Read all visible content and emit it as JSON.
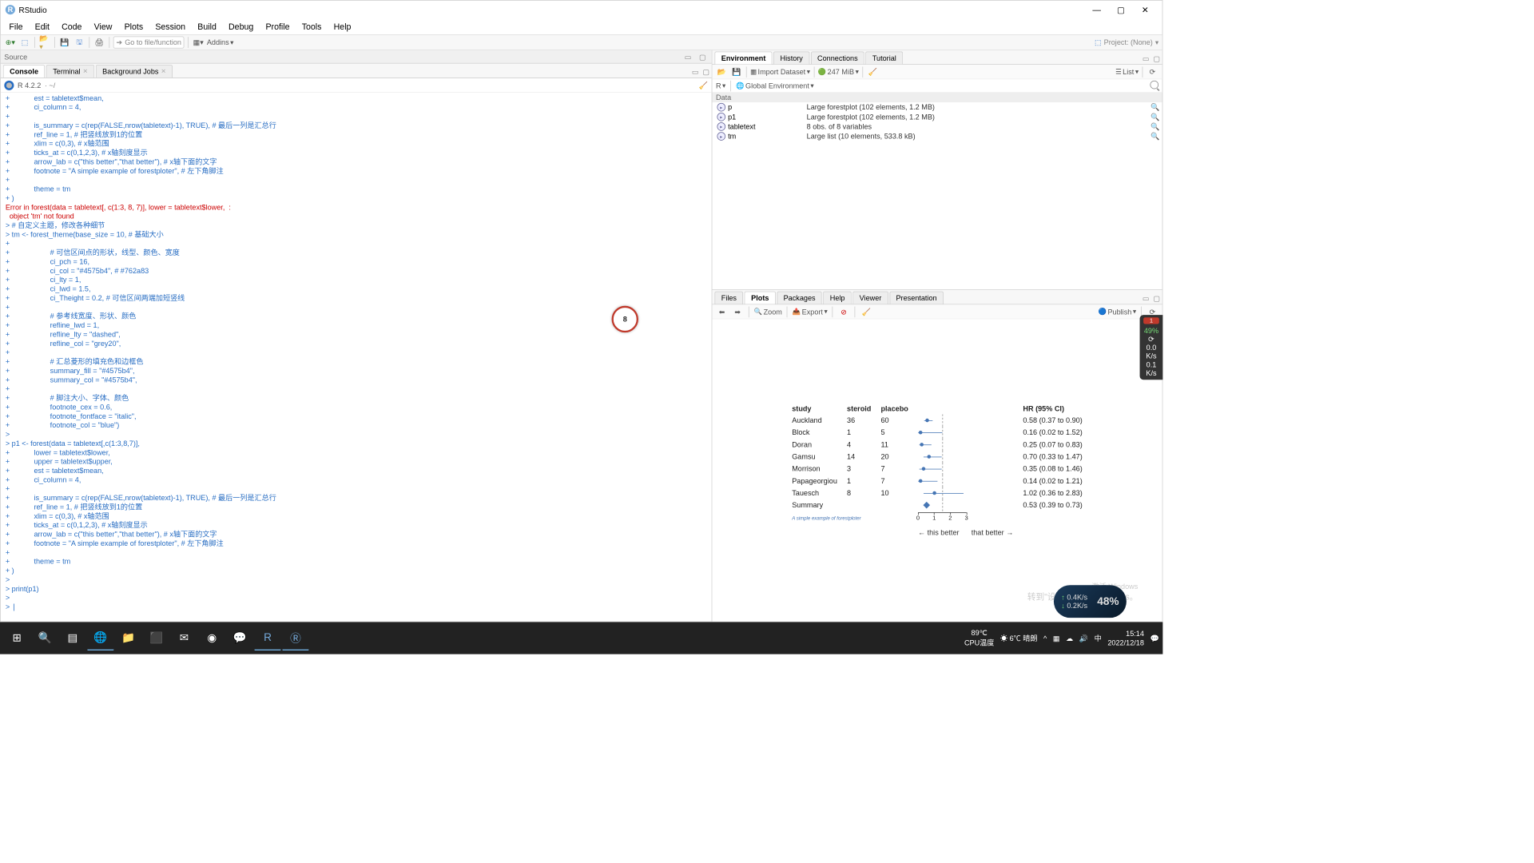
{
  "app": {
    "title": "RStudio"
  },
  "menu": [
    "File",
    "Edit",
    "Code",
    "View",
    "Plots",
    "Session",
    "Build",
    "Debug",
    "Profile",
    "Tools",
    "Help"
  ],
  "toolbar": {
    "goto_placeholder": "Go to file/function",
    "addins": "Addins",
    "project_label": "Project: (None)"
  },
  "source_pane": {
    "label": "Source"
  },
  "console_tabs": {
    "console": "Console",
    "terminal": "Terminal",
    "bgjobs": "Background Jobs"
  },
  "console_info": {
    "version": "R 4.2.2",
    "path": "~/"
  },
  "console_text": {
    "line1": "+            est = tabletext$mean,",
    "line2": "+            ci_column = 4,",
    "line3": "+            ",
    "line4": "+            is_summary = c(rep(FALSE,nrow(tabletext)-1), TRUE), # 最后一列是汇总行",
    "line5": "+            ref_line = 1, # 把竖线放到1的位置",
    "line6": "+            xlim = c(0,3), # x轴范围",
    "line7": "+            ticks_at = c(0,1,2,3), # x轴刻度显示",
    "line8": "+            arrow_lab = c(\"this better\",\"that better\"), # x轴下面的文字",
    "line9": "+            footnote = \"A simple example of forestploter\", # 左下角脚注",
    "line10": "+            ",
    "line11": "+            theme = tm",
    "line12": "+ )",
    "err1": "Error in forest(data = tabletext[, c(1:3, 8, 7)], lower = tabletext$lower,  : ",
    "err2": "  object 'tm' not found",
    "line13": "> # 自定义主题，修改各种细节",
    "line14": "> tm <- forest_theme(base_size = 10, # 基础大小",
    "line15": "+                    ",
    "line16": "+                    # 可信区间点的形状，线型、颜色、宽度",
    "line17": "+                    ci_pch = 16,",
    "line18": "+                    ci_col = \"#4575b4\", # #762a83",
    "line19": "+                    ci_lty = 1,",
    "line20": "+                    ci_lwd = 1.5,",
    "line21": "+                    ci_Theight = 0.2, # 可信区间两端加短竖线",
    "line22": "+                    ",
    "line23": "+                    # 参考线宽度、形状、颜色",
    "line24": "+                    refline_lwd = 1,",
    "line25": "+                    refline_lty = \"dashed\",",
    "line26": "+                    refline_col = \"grey20\",",
    "line27": "+                    ",
    "line28": "+                    # 汇总菱形的填充色和边框色",
    "line29": "+                    summary_fill = \"#4575b4\",",
    "line30": "+                    summary_col = \"#4575b4\",",
    "line31": "+                    ",
    "line32": "+                    # 脚注大小、字体、颜色",
    "line33": "+                    footnote_cex = 0.6,",
    "line34": "+                    footnote_fontface = \"italic\",",
    "line35": "+                    footnote_col = \"blue\")",
    "line36": "> ",
    "line37": "> p1 <- forest(data = tabletext[,c(1:3,8,7)],",
    "line38": "+            lower = tabletext$lower,",
    "line39": "+            upper = tabletext$upper,",
    "line40": "+            est = tabletext$mean,",
    "line41": "+            ci_column = 4,",
    "line42": "+            ",
    "line43": "+            is_summary = c(rep(FALSE,nrow(tabletext)-1), TRUE), # 最后一列是汇总行",
    "line44": "+            ref_line = 1, # 把竖线放到1的位置",
    "line45": "+            xlim = c(0,3), # x轴范围",
    "line46": "+            ticks_at = c(0,1,2,3), # x轴刻度显示",
    "line47": "+            arrow_lab = c(\"this better\",\"that better\"), # x轴下面的文字",
    "line48": "+            footnote = \"A simple example of forestploter\", # 左下角脚注",
    "line49": "+            ",
    "line50": "+            theme = tm",
    "line51": "+ )",
    "line52": "> ",
    "line53": "> print(p1)",
    "line54": "> ",
    "prompt": "> "
  },
  "badge_number": "8",
  "right_tabs_top": {
    "env": "Environment",
    "hist": "History",
    "conn": "Connections",
    "tut": "Tutorial"
  },
  "env_toolbar": {
    "import": "Import Dataset",
    "mem": "247 MiB",
    "view": "List",
    "scope1": "R",
    "scope2": "Global Environment"
  },
  "env_header": "Data",
  "env_rows": [
    {
      "name": "p",
      "value": "Large forestplot (102 elements, 1.2 MB)"
    },
    {
      "name": "p1",
      "value": "Large forestplot (102 elements, 1.2 MB)"
    },
    {
      "name": "tabletext",
      "value": "8 obs. of 8 variables"
    },
    {
      "name": "tm",
      "value": "Large list (10 elements, 533.8 kB)"
    }
  ],
  "right_tabs_bot": {
    "files": "Files",
    "plots": "Plots",
    "pkgs": "Packages",
    "help": "Help",
    "viewer": "Viewer",
    "pres": "Presentation"
  },
  "plot_toolbar": {
    "zoom": "Zoom",
    "export": "Export",
    "publish": "Publish"
  },
  "chart_data": {
    "type": "forestplot",
    "columns": [
      "study",
      "steroid",
      "placebo",
      "HR (95% CI)"
    ],
    "rows": [
      {
        "study": "Auckland",
        "steroid": "36",
        "placebo": "60",
        "hr_text": "0.58 (0.37 to 0.90)",
        "est": 0.58,
        "low": 0.37,
        "high": 0.9
      },
      {
        "study": "Block",
        "steroid": "1",
        "placebo": "5",
        "hr_text": "0.16 (0.02 to 1.52)",
        "est": 0.16,
        "low": 0.02,
        "high": 1.52
      },
      {
        "study": "Doran",
        "steroid": "4",
        "placebo": "11",
        "hr_text": "0.25 (0.07 to 0.83)",
        "est": 0.25,
        "low": 0.07,
        "high": 0.83
      },
      {
        "study": "Gamsu",
        "steroid": "14",
        "placebo": "20",
        "hr_text": "0.70 (0.33 to 1.47)",
        "est": 0.7,
        "low": 0.33,
        "high": 1.47
      },
      {
        "study": "Morrison",
        "steroid": "3",
        "placebo": "7",
        "hr_text": "0.35 (0.08 to 1.46)",
        "est": 0.35,
        "low": 0.08,
        "high": 1.46
      },
      {
        "study": "Papageorgiou",
        "steroid": "1",
        "placebo": "7",
        "hr_text": "0.14 (0.02 to 1.21)",
        "est": 0.14,
        "low": 0.02,
        "high": 1.21
      },
      {
        "study": "Tauesch",
        "steroid": "8",
        "placebo": "10",
        "hr_text": "1.02 (0.36 to 2.83)",
        "est": 1.02,
        "low": 0.36,
        "high": 2.83
      }
    ],
    "summary": {
      "study": "Summary",
      "steroid": "",
      "placebo": "",
      "hr_text": "0.53 (0.39 to 0.73)",
      "est": 0.53,
      "low": 0.39,
      "high": 0.73
    },
    "footnote": "A simple example of forestploter",
    "xlim": [
      0,
      3
    ],
    "ticks": [
      0,
      1,
      2,
      3
    ],
    "arrow_left": "this better",
    "arrow_right": "that better"
  },
  "watermark": {
    "line1": "激活 Windows",
    "line2": "转到\"设置\"以激活 Windows。"
  },
  "taskbar": {
    "temp1": "89℃",
    "temp1_label": "CPU温度",
    "weather": "6℃ 晴朗",
    "time": "15:14",
    "date": "2022/12/18"
  },
  "side": {
    "badge": "1",
    "pct": "49%",
    "v1": "0.0",
    "u1": "K/s",
    "v2": "0.1",
    "u2": "K/s"
  },
  "net": {
    "up": "0.4K/s",
    "down": "0.2K/s",
    "pct": "48%"
  }
}
